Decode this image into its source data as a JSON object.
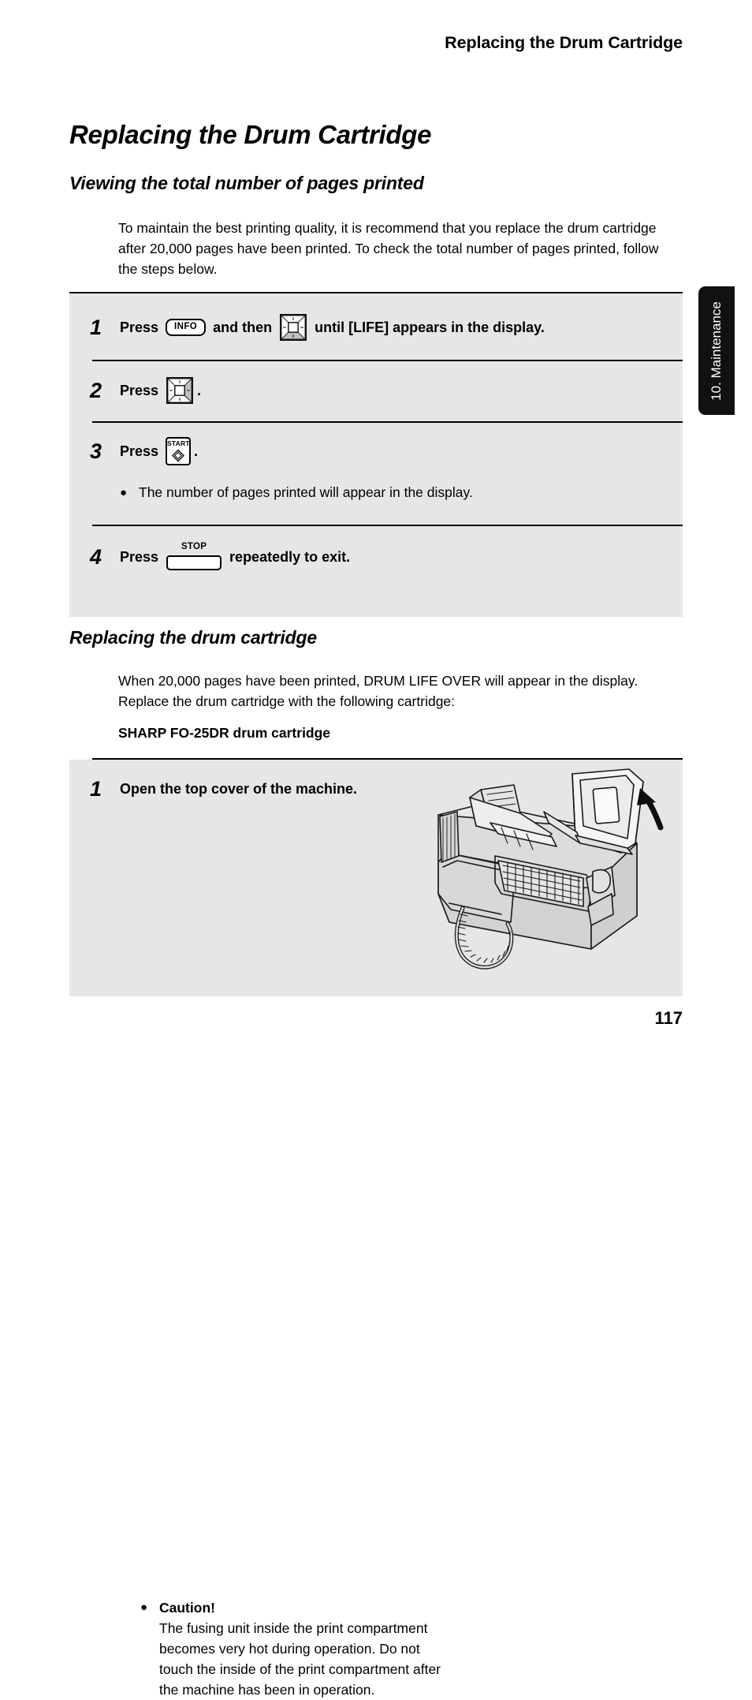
{
  "running_header": "Replacing the Drum Cartridge",
  "side_tab": {
    "label": "10. Maintenance"
  },
  "doc_title": "Replacing the Drum Cartridge",
  "sections": {
    "viewing": {
      "heading": "Viewing the total number of pages printed",
      "intro": "To maintain the best printing quality, it is recommend that you replace the drum cartridge after 20,000 pages have been printed. To check the total number of pages printed, follow the steps below.",
      "steps": [
        {
          "number": "1",
          "text_before": "Press ",
          "key1": "INFO",
          "text_middle": " and then ",
          "key2": "arrow-pad-down",
          "text_after": " until [LIFE] appears in the display."
        },
        {
          "number": "2",
          "text_before": "Press ",
          "key1": "arrow-pad-right",
          "text_after": "."
        },
        {
          "number": "3",
          "text_before": "Press ",
          "key1": "START",
          "text_after": ".",
          "bullet": "The number of pages printed will appear in the display."
        },
        {
          "number": "4",
          "text_before": "Press ",
          "key1": "STOP",
          "text_after": " repeatedly to exit."
        }
      ]
    },
    "replacing": {
      "heading": "Replacing the drum cartridge",
      "intro": "When 20,000 pages have been printed, DRUM LIFE OVER will appear in the display. Replace the drum cartridge with the following cartridge:",
      "cartridge_name": "SHARP FO-25DR drum cartridge",
      "steps": [
        {
          "number": "1",
          "heading": "Open the top cover of the machine.",
          "caution_title": "Caution!",
          "caution_text": "The fusing unit inside the print compartment becomes very hot during operation. Do not touch the inside of the print compartment after the machine has been in operation."
        }
      ]
    }
  },
  "illustration": {
    "alt": "fax machine with top cover open and upward arrow"
  },
  "page_number": "117",
  "colors": {
    "panel_background": "#e6e6e6",
    "tab_background": "#111111",
    "text": "#000000",
    "page_background": "#ffffff"
  }
}
